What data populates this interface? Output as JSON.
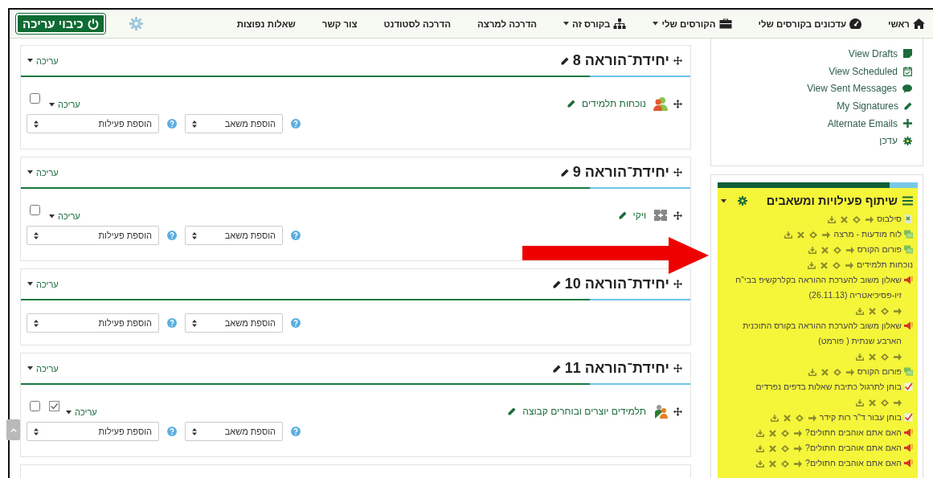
{
  "nav": {
    "items": [
      {
        "label": "ראשי",
        "dropdown": false
      },
      {
        "label": "עדכונים בקורסים שלי",
        "dropdown": false
      },
      {
        "label": "הקורסים שלי",
        "dropdown": true
      },
      {
        "label": "בקורס זה",
        "dropdown": true
      },
      {
        "label": "הדרכה למרצה",
        "dropdown": false
      },
      {
        "label": "הדרכה לסטודנט",
        "dropdown": false
      },
      {
        "label": "צור קשר",
        "dropdown": false
      },
      {
        "label": "שאלות נפוצות",
        "dropdown": false
      }
    ],
    "edit_button": "כיבוי עריכה"
  },
  "sections": [
    {
      "title": "יחידת־הוראה 8",
      "edit_menu": "עריכה",
      "activities": [
        {
          "kind": "attendance",
          "name": "נוכחות תלמידים",
          "edit_menu": "עריכה",
          "selected": false,
          "completion": false
        }
      ],
      "add_resource": "הוספת משאב",
      "add_activity": "הוספת פעילות"
    },
    {
      "title": "יחידת־הוראה 9",
      "edit_menu": "עריכה",
      "activities": [
        {
          "kind": "wiki",
          "name": "ויקי",
          "edit_menu": "עריכה",
          "selected": false,
          "completion": false
        }
      ],
      "add_resource": "הוספת משאב",
      "add_activity": "הוספת פעילות"
    },
    {
      "title": "יחידת־הוראה 10",
      "edit_menu": "עריכה",
      "add_resource": "הוספת משאב",
      "add_activity": "הוספת פעילות"
    },
    {
      "title": "יחידת־הוראה 11",
      "edit_menu": "עריכה",
      "activities": [
        {
          "kind": "group",
          "name": "תלמידים יוצרים ובוחרים קבוצה",
          "edit_menu": "עריכה",
          "selected": false,
          "completion": true
        }
      ],
      "add_resource": "הוספת משאב",
      "add_activity": "הוספת פעילות"
    }
  ],
  "messages_block": {
    "items": [
      {
        "label": "View Drafts"
      },
      {
        "label": "View Scheduled"
      },
      {
        "label": "View Sent Messages"
      },
      {
        "label": "My Signatures"
      },
      {
        "label": "Alternate Emails"
      },
      {
        "label": "עדכן"
      }
    ]
  },
  "sharing_block": {
    "title": "שיתוף פעילויות ומשאבים",
    "items": [
      {
        "kind": "file",
        "name": "סילבוס"
      },
      {
        "kind": "forum",
        "name": "לוח מודעות - מרצה"
      },
      {
        "kind": "forum",
        "name": "פורום הקורס"
      },
      {
        "kind": "plain",
        "name": "נוכחות תלמידים"
      },
      {
        "kind": "feedback",
        "name": "שאלון משוב להערכת ההוראה בקלרקשיפ בבי\"ח זיו-פסיכיאטריה (26.11.13)"
      },
      {
        "kind": "feedback",
        "name": "שאלון משוב להערכת ההוראה בקורס התוכנית הארבע שנתית ( פורמט)"
      },
      {
        "kind": "forum",
        "name": "פורום הקורס"
      },
      {
        "kind": "quiz",
        "name": "בוחן לתרגול כתיבת שאלות בדפים נפרדים"
      },
      {
        "kind": "quiz",
        "name": "בוחן עבור ד\"ר רות קידר"
      },
      {
        "kind": "feedback",
        "name": "האם אתם אוהבים חתולים?"
      },
      {
        "kind": "feedback",
        "name": "האם אתם אוהבים חתולים?"
      },
      {
        "kind": "feedback",
        "name": "האם אתם אוהבים חתולים?"
      }
    ]
  }
}
